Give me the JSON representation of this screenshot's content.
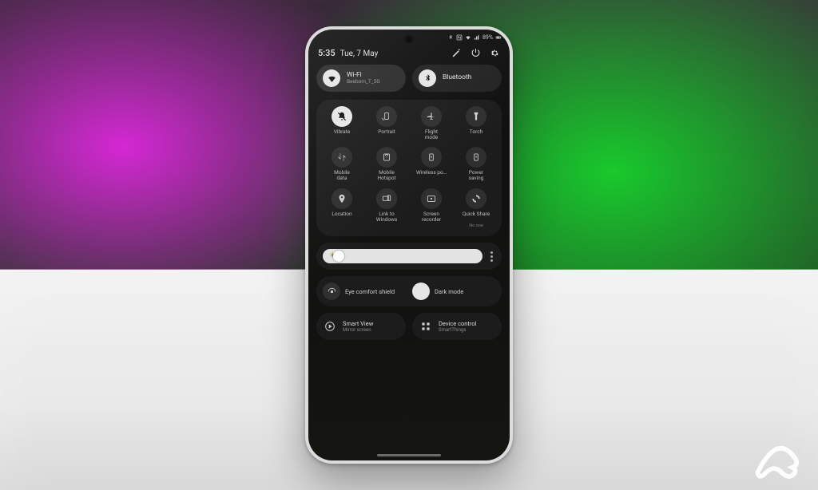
{
  "status": {
    "battery_text": "89%"
  },
  "header": {
    "time": "5:35",
    "date": "Tue, 7 May"
  },
  "conn": {
    "wifi": {
      "title": "Wi-Fi",
      "subtitle": "Beebom_T_5G"
    },
    "bluetooth": {
      "title": "Bluetooth"
    }
  },
  "tiles": [
    {
      "label": "Vibrate",
      "sub": ""
    },
    {
      "label": "Portrait",
      "sub": ""
    },
    {
      "label": "Flight\nmode",
      "sub": ""
    },
    {
      "label": "Torch",
      "sub": ""
    },
    {
      "label": "Mobile\ndata",
      "sub": ""
    },
    {
      "label": "Mobile\nHotspot",
      "sub": ""
    },
    {
      "label": "Wireless po…",
      "sub": ""
    },
    {
      "label": "Power\nsaving",
      "sub": ""
    },
    {
      "label": "Location",
      "sub": ""
    },
    {
      "label": "Link to\nWindows",
      "sub": ""
    },
    {
      "label": "Screen\nrecorder",
      "sub": ""
    },
    {
      "label": "Quick Share",
      "sub": "No one"
    }
  ],
  "brightness": {
    "value_pct": 10
  },
  "toggles": {
    "eye_comfort": "Eye comfort shield",
    "dark_mode": "Dark mode"
  },
  "bottom": {
    "smart_view": {
      "title": "Smart View",
      "subtitle": "Mirror screen"
    },
    "device_control": {
      "title": "Device control",
      "subtitle": "SmartThings"
    }
  }
}
